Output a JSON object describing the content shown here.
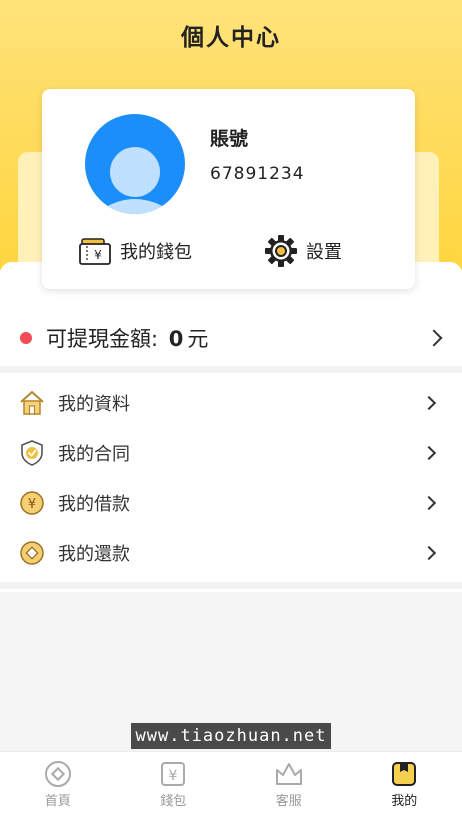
{
  "header": {
    "title": "個人中心"
  },
  "profile": {
    "account_label": "賬號",
    "account_id": "67891234",
    "wallet_label": "我的錢包",
    "settings_label": "設置"
  },
  "balance": {
    "label": "可提現金額:",
    "amount": "0",
    "unit": "元"
  },
  "menu": [
    {
      "label": "我的資料",
      "icon": "house-icon"
    },
    {
      "label": "我的合同",
      "icon": "shield-check-icon"
    },
    {
      "label": "我的借款",
      "icon": "yen-coin-icon"
    },
    {
      "label": "我的還款",
      "icon": "coin-icon"
    }
  ],
  "watermark": "www.tiaozhuan.net",
  "tabs": [
    {
      "label": "首頁",
      "icon": "home-coin-icon",
      "active": false
    },
    {
      "label": "錢包",
      "icon": "wallet-yen-icon",
      "active": false
    },
    {
      "label": "客服",
      "icon": "crown-icon",
      "active": false
    },
    {
      "label": "我的",
      "icon": "profile-card-icon",
      "active": true
    }
  ],
  "colors": {
    "header_yellow": "#ffd63f",
    "avatar_blue": "#1c8ef9",
    "dot_red": "#f24b55",
    "icon_gold": "#f0c040"
  }
}
